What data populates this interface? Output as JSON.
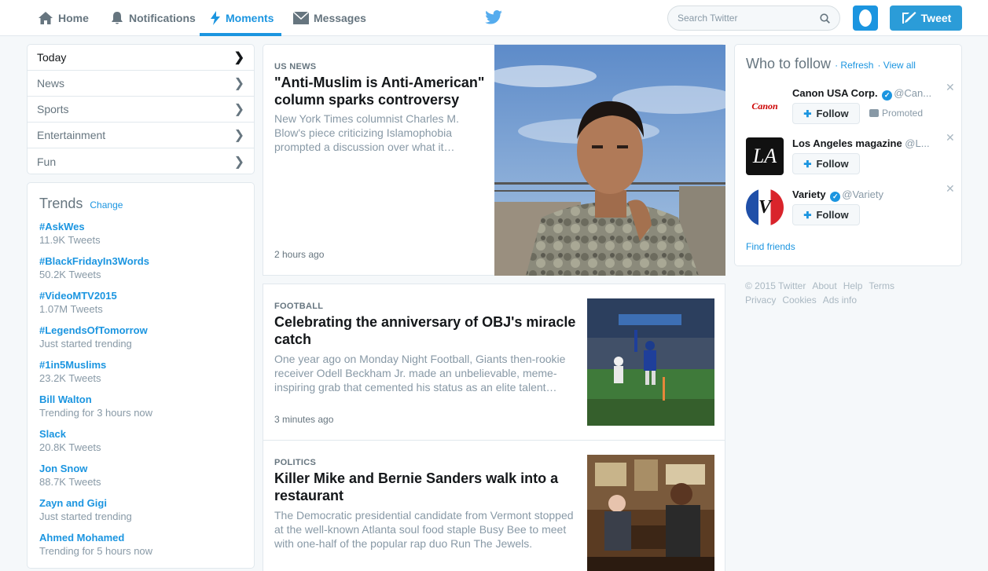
{
  "nav": {
    "home": "Home",
    "notifications": "Notifications",
    "moments": "Moments",
    "messages": "Messages",
    "search_placeholder": "Search Twitter",
    "tweet": "Tweet"
  },
  "categories": [
    {
      "label": "Today",
      "active": true
    },
    {
      "label": "News",
      "active": false
    },
    {
      "label": "Sports",
      "active": false
    },
    {
      "label": "Entertainment",
      "active": false
    },
    {
      "label": "Fun",
      "active": false
    }
  ],
  "trends": {
    "title": "Trends",
    "change": "Change",
    "items": [
      {
        "name": "#AskWes",
        "meta": "11.9K Tweets"
      },
      {
        "name": "#BlackFridayIn3Words",
        "meta": "50.2K Tweets"
      },
      {
        "name": "#VideoMTV2015",
        "meta": "1.07M Tweets"
      },
      {
        "name": "#LegendsOfTomorrow",
        "meta": "Just started trending"
      },
      {
        "name": "#1in5Muslims",
        "meta": "23.2K Tweets"
      },
      {
        "name": "Bill Walton",
        "meta": "Trending for 3 hours now"
      },
      {
        "name": "Slack",
        "meta": "20.8K Tweets"
      },
      {
        "name": "Jon Snow",
        "meta": "88.7K Tweets"
      },
      {
        "name": "Zayn and Gigi",
        "meta": "Just started trending"
      },
      {
        "name": "Ahmed Mohamed",
        "meta": "Trending for 5 hours now"
      }
    ]
  },
  "moments": [
    {
      "category": "US NEWS",
      "headline": "\"Anti-Muslim is Anti-American\" column sparks controversy",
      "summary": "New York Times columnist Charles M. Blow's piece criticizing Islamophobia prompted a discussion over what it…",
      "time": "2 hours ago"
    },
    {
      "category": "FOOTBALL",
      "headline": "Celebrating the anniversary of OBJ's miracle catch",
      "summary": "One year ago on Monday Night Football, Giants then-rookie receiver Odell Beckham Jr. made an unbelievable, meme-inspiring grab that cemented his status as an elite talent…",
      "time": "3 minutes ago"
    },
    {
      "category": "POLITICS",
      "headline": "Killer Mike and Bernie Sanders walk into a restaurant",
      "summary": "The Democratic presidential candidate from Vermont stopped at the well-known Atlanta soul food staple Busy Bee to meet with one-half of the popular rap duo Run The Jewels.",
      "time": ""
    }
  ],
  "who_to_follow": {
    "title": "Who to follow",
    "refresh": "Refresh",
    "view_all": "View all",
    "follow_label": "Follow",
    "accounts": [
      {
        "name": "Canon USA Corp.",
        "handle": "@Can...",
        "logo_text": "Canon",
        "promoted": "Promoted"
      },
      {
        "name": "Los Angeles magazine",
        "handle": "@L...",
        "logo_text": "LA"
      },
      {
        "name": "Variety",
        "handle": "@Variety",
        "logo_text": "V"
      }
    ],
    "find_friends": "Find friends"
  },
  "footer": {
    "copyright": "© 2015 Twitter",
    "about": "About",
    "help": "Help",
    "terms": "Terms",
    "privacy": "Privacy",
    "cookies": "Cookies",
    "ads_info": "Ads info"
  },
  "colors": {
    "accent": "#1b95e0",
    "tweet_button": "#2b9cd8",
    "background": "#f5f8fa"
  }
}
